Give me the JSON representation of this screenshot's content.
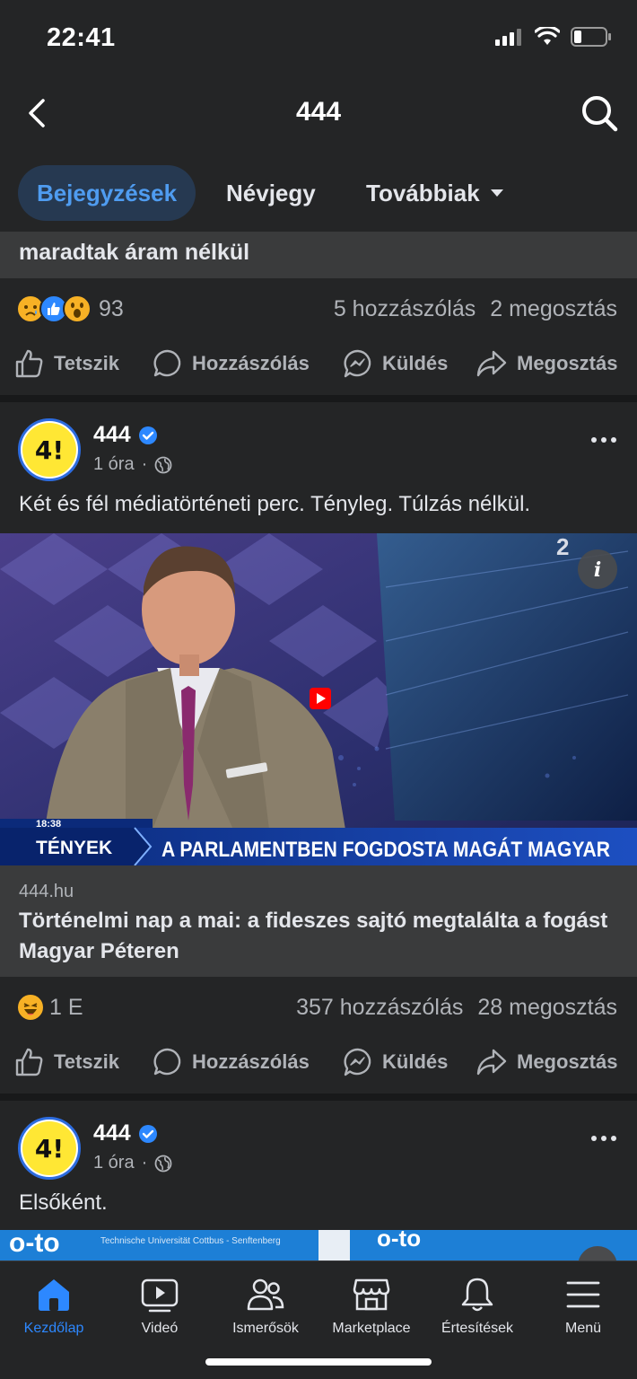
{
  "status_bar": {
    "time": "22:41"
  },
  "nav": {
    "title": "444"
  },
  "tabs": [
    {
      "label": "Bejegyzések"
    },
    {
      "label": "Névjegy"
    },
    {
      "label": "Továbbiak"
    }
  ],
  "prev_post": {
    "text_tail": "maradtak áram nélkül",
    "reaction_count": "93",
    "comments": "5 hozzászólás",
    "shares": "2 megosztás"
  },
  "actions": {
    "like": "Tetszik",
    "comment": "Hozzászólás",
    "send": "Küldés",
    "share": "Megosztás"
  },
  "post1": {
    "author": "444",
    "time": "1 óra",
    "separator": "·",
    "text": "Két és fél médiatörténeti perc. Tényleg. Túlzás nélkül.",
    "media": {
      "timestamp": "18:38",
      "channel": "TÉNYEK",
      "headline": "A PARLAMENTBEN FOGDOSTA MAGÁT MAGYAR",
      "corner_logo": "2"
    },
    "link_domain": "444.hu",
    "link_title": "Történelmi nap a mai: a fideszes sajtó megtalálta a fogást Magyar Péteren",
    "reaction_count": "1 E",
    "comments": "357 hozzászólás",
    "shares": "28 megosztás"
  },
  "post2": {
    "author": "444",
    "time": "1 óra",
    "separator": "·",
    "text": "Elsőként.",
    "media_text_left": "Technische Universität Cottbus - Senftenberg"
  },
  "bottom_nav": [
    {
      "label": "Kezdőlap"
    },
    {
      "label": "Videó"
    },
    {
      "label": "Ismerősök"
    },
    {
      "label": "Marketplace"
    },
    {
      "label": "Értesítések"
    },
    {
      "label": "Menü"
    }
  ],
  "colors": {
    "background": "#242526",
    "accent": "#2d88ff",
    "tab_active_bg": "#263951",
    "card": "#3a3b3c"
  }
}
